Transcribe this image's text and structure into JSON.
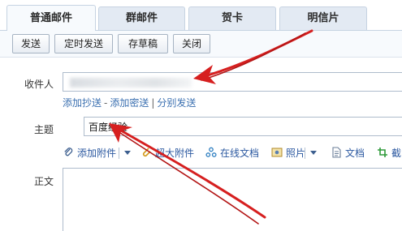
{
  "tabs": [
    {
      "label": "普通邮件",
      "active": true
    },
    {
      "label": "群邮件",
      "active": false
    },
    {
      "label": "贺卡",
      "active": false
    },
    {
      "label": "明信片",
      "active": false
    }
  ],
  "toolbar": {
    "send": "发送",
    "scheduled_send": "定时发送",
    "save_draft": "存草稿",
    "close": "关闭"
  },
  "recipient": {
    "label": "收件人",
    "value_obscured": true
  },
  "recipient_links": {
    "add_cc": "添加抄送",
    "dash": "-",
    "add_bcc": "添加密送",
    "bar": "|",
    "separate_send": "分别发送"
  },
  "subject": {
    "label": "主题",
    "value": "百度经验"
  },
  "attachments": {
    "add_attachment": "添加附件",
    "large_attachment": "超大附件",
    "online_docs": "在线文档",
    "photos": "照片",
    "documents": "文档",
    "screenshot": "截"
  },
  "body": {
    "label": "正文"
  },
  "icons": [
    "paperclip-icon",
    "large-attachment-icon",
    "online-docs-icon",
    "photo-icon",
    "document-icon",
    "screenshot-icon",
    "dropdown-caret-icon"
  ],
  "colors": {
    "accent_link": "#3a6fb0",
    "tab_bg": "#e3eaf3",
    "arrow": "#d61f1f"
  }
}
